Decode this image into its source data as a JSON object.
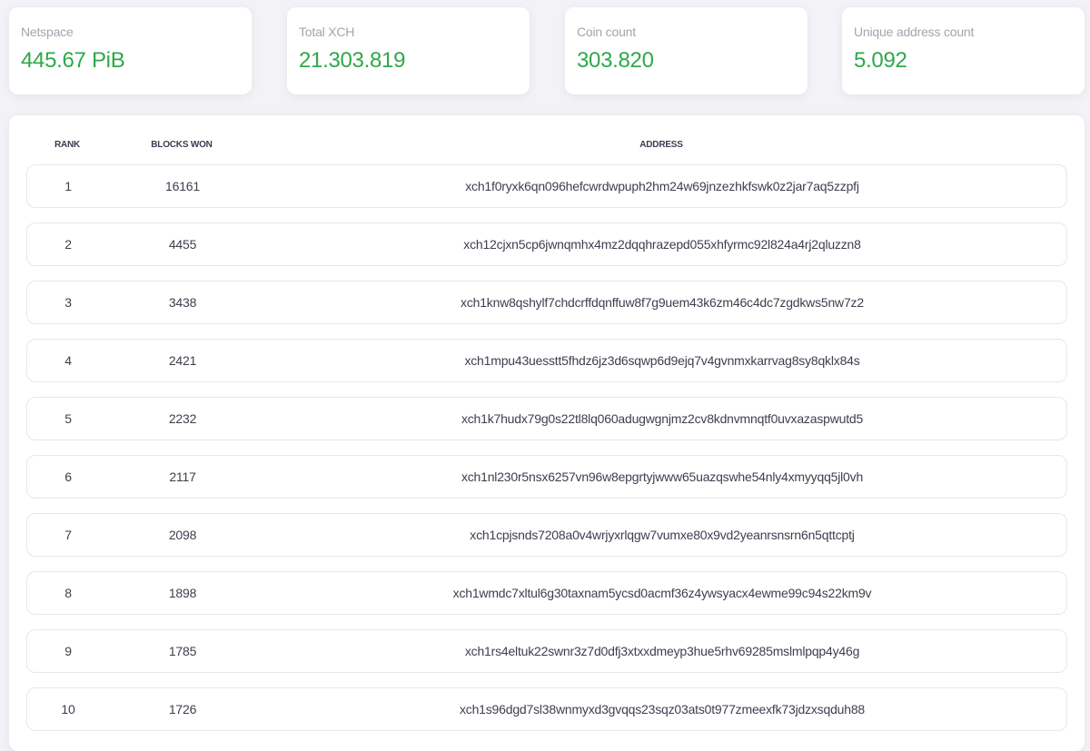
{
  "stats": [
    {
      "label": "Netspace",
      "value": "445.67 PiB"
    },
    {
      "label": "Total XCH",
      "value": "21.303.819"
    },
    {
      "label": "Coin count",
      "value": "303.820"
    },
    {
      "label": "Unique address count",
      "value": "5.092"
    }
  ],
  "table": {
    "headers": {
      "rank": "RANK",
      "blocks_won": "BLOCKS WON",
      "address": "ADDRESS"
    },
    "rows": [
      {
        "rank": "1",
        "blocks_won": "16161",
        "address": "xch1f0ryxk6qn096hefcwrdwpuph2hm24w69jnzezhkfswk0z2jar7aq5zzpfj"
      },
      {
        "rank": "2",
        "blocks_won": "4455",
        "address": "xch12cjxn5cp6jwnqmhx4mz2dqqhrazepd055xhfyrmc92l824a4rj2qluzzn8"
      },
      {
        "rank": "3",
        "blocks_won": "3438",
        "address": "xch1knw8qshylf7chdcrffdqnffuw8f7g9uem43k6zm46c4dc7zgdkws5nw7z2"
      },
      {
        "rank": "4",
        "blocks_won": "2421",
        "address": "xch1mpu43uesstt5fhdz6jz3d6sqwp6d9ejq7v4gvnmxkarrvag8sy8qklx84s"
      },
      {
        "rank": "5",
        "blocks_won": "2232",
        "address": "xch1k7hudx79g0s22tl8lq060adugwgnjmz2cv8kdnvmnqtf0uvxazaspwutd5"
      },
      {
        "rank": "6",
        "blocks_won": "2117",
        "address": "xch1nl230r5nsx6257vn96w8epgrtyjwww65uazqswhe54nly4xmyyqq5jl0vh"
      },
      {
        "rank": "7",
        "blocks_won": "2098",
        "address": "xch1cpjsnds7208a0v4wrjyxrlqgw7vumxe80x9vd2yeanrsnsrn6n5qttcptj"
      },
      {
        "rank": "8",
        "blocks_won": "1898",
        "address": "xch1wmdc7xltul6g30taxnam5ycsd0acmf36z4ywsyacx4ewme99c94s22km9v"
      },
      {
        "rank": "9",
        "blocks_won": "1785",
        "address": "xch1rs4eltuk22swnr3z7d0dfj3xtxxdmeyp3hue5rhv69285mslmlpqp4y46g"
      },
      {
        "rank": "10",
        "blocks_won": "1726",
        "address": "xch1s96dgd7sl38wnmyxd3gvqqs23sqz03ats0t977zmeexfk73jdzxsqduh88"
      }
    ]
  }
}
